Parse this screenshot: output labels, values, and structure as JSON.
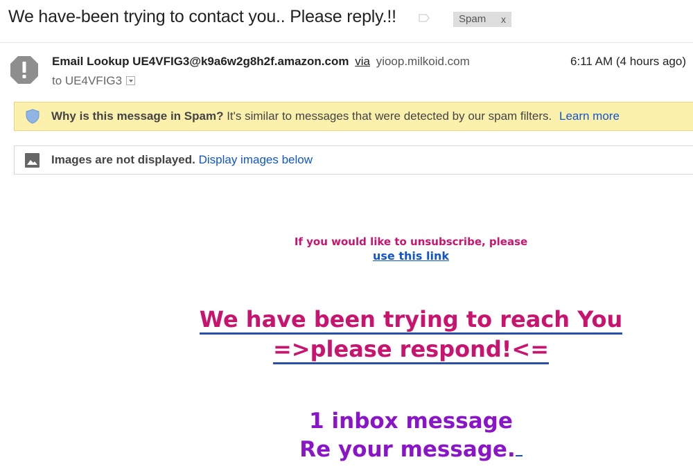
{
  "email": {
    "subject": "We have-been trying to contact you.. Please reply.!!",
    "label_chip": {
      "text": "Spam",
      "close": "x"
    },
    "sender": {
      "name": "Email Lookup UE4VFIG3@k9a6w2g8h2f.amazon.com",
      "via": "via",
      "via_domain": "yioop.milkoid.com"
    },
    "time": "6:11 AM (4 hours ago)",
    "recipient": "to UE4VFIG3"
  },
  "spam_banner": {
    "question": "Why is this message in Spam?",
    "explanation": "It's similar to messages that were detected by our spam filters.",
    "learn_more": "Learn more"
  },
  "images_banner": {
    "notice": "Images are not displayed.",
    "action": "Display images below"
  },
  "body": {
    "unsubscribe_text": "If you would like to unsubscribe, please",
    "unsubscribe_link": "use this link",
    "headline_line1": "We have been trying to reach You",
    "headline_line2": "=>please respond!<=",
    "inbox_line1": "1 inbox message",
    "inbox_line2": "Re your message."
  },
  "icons": {
    "avatar": "exclamation-icon",
    "label": "label-tag-icon",
    "shield": "shield-icon",
    "image": "image-icon",
    "dropdown": "chevron-down-icon"
  },
  "colors": {
    "spam_banner_bg": "#fcf0ad",
    "link": "#1155cc",
    "magenta": "#c8146e",
    "purple": "#8a14c8"
  }
}
